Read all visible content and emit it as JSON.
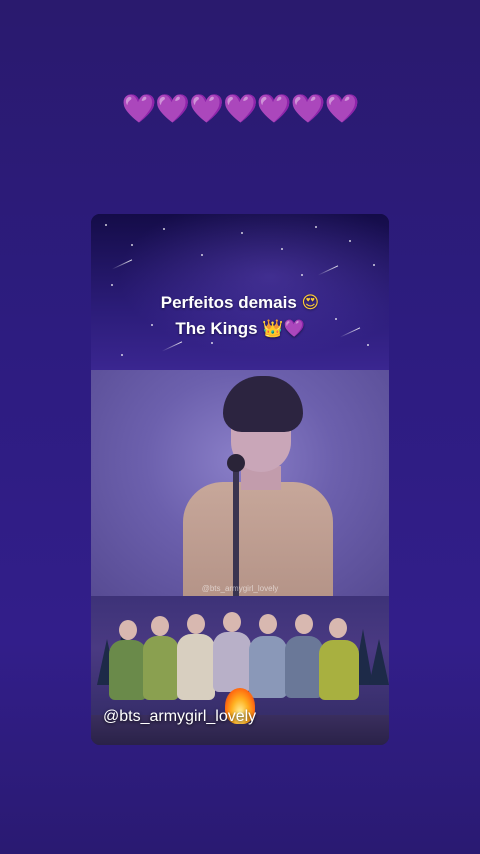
{
  "story": {
    "hearts": "💜💜💜💜💜💜💜",
    "caption": {
      "line1_text": "Perfeitos demais",
      "line1_emoji": "😍",
      "line2_text": "The Kings",
      "line2_emoji_crown": "👑",
      "line2_emoji_heart": "💜"
    },
    "video_watermark": "@bts_armygirl_lovely",
    "handle": "@bts_armygirl_lovely"
  },
  "colors": {
    "background": "#2d1c80",
    "heart": "#b05cf0",
    "caption_text": "#ffffff"
  }
}
